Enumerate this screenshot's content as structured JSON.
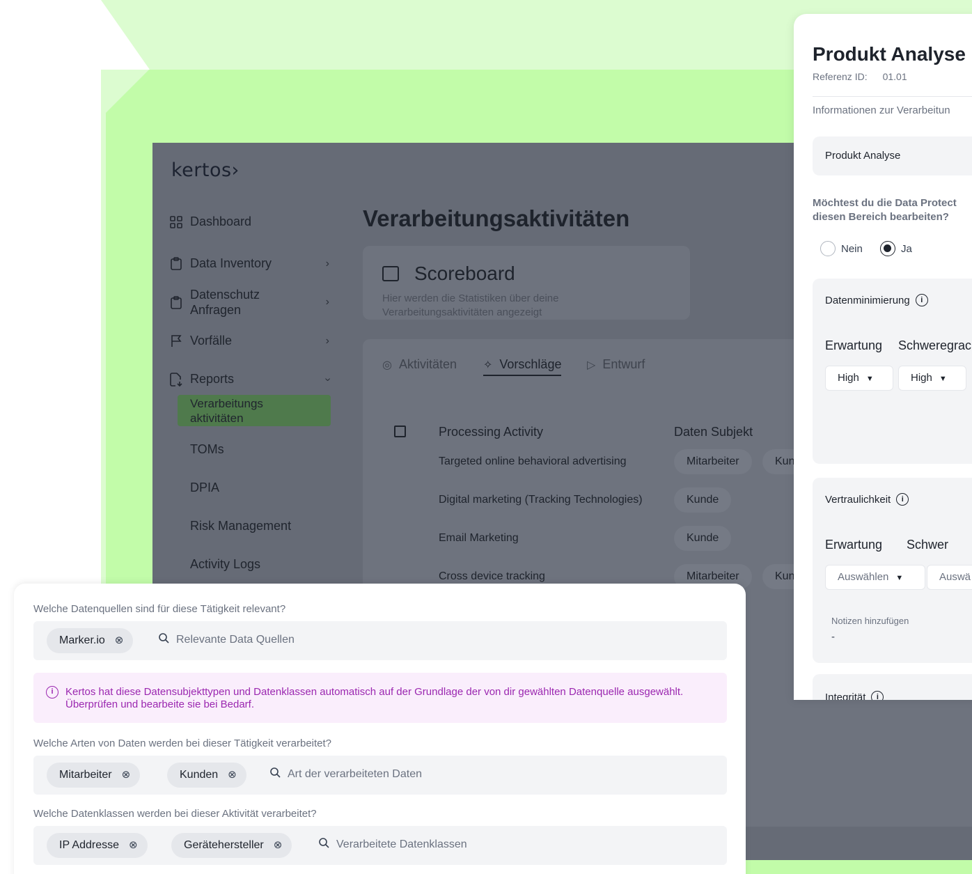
{
  "sidebar": {
    "logo": "kertos›",
    "items": [
      {
        "label": "Dashboard"
      },
      {
        "label": "Data Inventory"
      },
      {
        "label": "Datenschutz Anfragen"
      },
      {
        "label": "Vorfälle"
      },
      {
        "label": "Reports"
      }
    ],
    "sub_items": {
      "active": "Verarbeitungs aktivitäten",
      "toms": "TOMs",
      "dpia": "DPIA",
      "risk": "Risk Management",
      "logs": "Activity Logs"
    }
  },
  "main": {
    "title": "Verarbeitungsaktivitäten",
    "scoreboard": {
      "title": "Scoreboard",
      "subtitle": "Hier werden die Statistiken über deine Verarbeitungsaktivitäten angezeigt"
    },
    "tabs": [
      {
        "label": "Aktivitäten"
      },
      {
        "label": "Vorschläge"
      },
      {
        "label": "Entwurf"
      }
    ],
    "table": {
      "headers": [
        "Processing Activity",
        "Daten Subjekt"
      ],
      "rows": [
        {
          "activity": "Targeted online behavioral advertising",
          "subjects": [
            "Mitarbeiter",
            "Kun"
          ]
        },
        {
          "activity": "Digital marketing (Tracking Technologies)",
          "subjects": [
            "Kunde"
          ]
        },
        {
          "activity": "Email Marketing",
          "subjects": [
            "Kunde"
          ]
        },
        {
          "activity": "Cross device tracking",
          "subjects": [
            "Mitarbeiter",
            "Kun"
          ]
        }
      ]
    }
  },
  "panel": {
    "title": "Produkt Analyse",
    "ref_label": "Referenz ID:",
    "ref_value": "01.01",
    "section": "Informationen zur Verarbeitun",
    "name": "Produkt Analyse",
    "question_line1": "Möchtest du die Data Protect",
    "question_line2": "diesen Bereich bearbeiten?",
    "radio_no": "Nein",
    "radio_yes": "Ja",
    "datenminimierung": {
      "label": "Datenminimierung",
      "erwartung": "Erwartung",
      "schweregrad": "Schweregrac",
      "value1": "High",
      "value2": "High"
    },
    "vertraulichkeit": {
      "label": "Vertraulichkeit",
      "erwartung": "Erwartung",
      "schweregrad": "Schwer",
      "value1": "Auswählen",
      "value2": "Auswä",
      "notes_label": "Notizen hinzufügen",
      "notes_value": "-"
    },
    "integritaet": "Integrität"
  },
  "form": {
    "q1": "Welche Datenquellen sind für diese Tätigkeit relevant?",
    "q1_tags": [
      "Marker.io"
    ],
    "q1_placeholder": "Relevante Data Quellen",
    "notice": "Kertos hat diese Datensubjekttypen und Datenklassen automatisch auf der Grundlage der von dir gewählten Datenquelle ausgewählt. Überprüfen und bearbeite  sie bei Bedarf.",
    "q2": "Welche Arten von Daten werden bei dieser Tätigkeit verarbeitet?",
    "q2_tags": [
      "Mitarbeiter",
      "Kunden"
    ],
    "q2_placeholder": "Art der verarbeiteten Daten",
    "q3": "Welche Datenklassen werden bei dieser Aktivität verarbeitet?",
    "q3_tags": [
      "IP Addresse",
      "Gerätehersteller"
    ],
    "q3_placeholder": "Verarbeitete Datenklassen"
  }
}
